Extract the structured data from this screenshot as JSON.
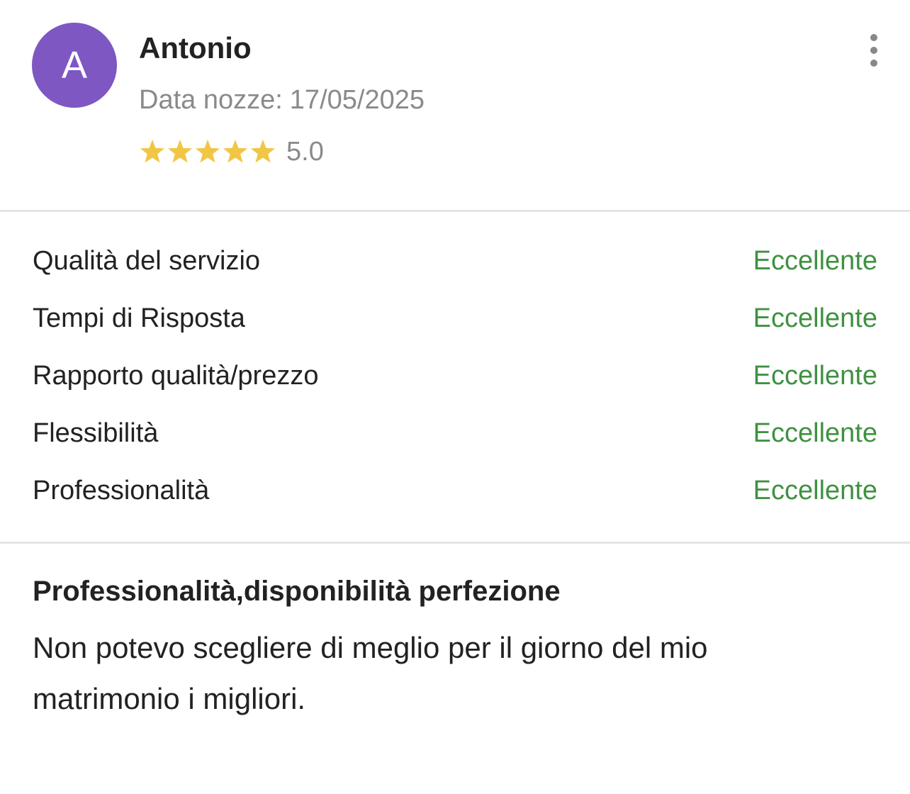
{
  "review": {
    "avatar_initial": "A",
    "avatar_color": "#7e57c2",
    "reviewer_name": "Antonio",
    "wedding_date_label": "Data nozze:",
    "wedding_date": "17/05/2025",
    "rating": 5.0,
    "rating_max": 5,
    "rating_text": "5.0",
    "star_color": "#f1c644",
    "more_icon": "more-vertical-icon"
  },
  "criteria": [
    {
      "label": "Qualità del servizio",
      "value": "Eccellente"
    },
    {
      "label": "Tempi di Risposta",
      "value": "Eccellente"
    },
    {
      "label": "Rapporto qualità/prezzo",
      "value": "Eccellente"
    },
    {
      "label": "Flessibilità",
      "value": "Eccellente"
    },
    {
      "label": "Professionalità",
      "value": "Eccellente"
    }
  ],
  "criteria_value_color": "#3f9142",
  "body": {
    "title": "Professionalità,disponibilità perfezione",
    "text": "Non potevo scegliere di meglio per il giorno del mio matrimonio i migliori."
  }
}
